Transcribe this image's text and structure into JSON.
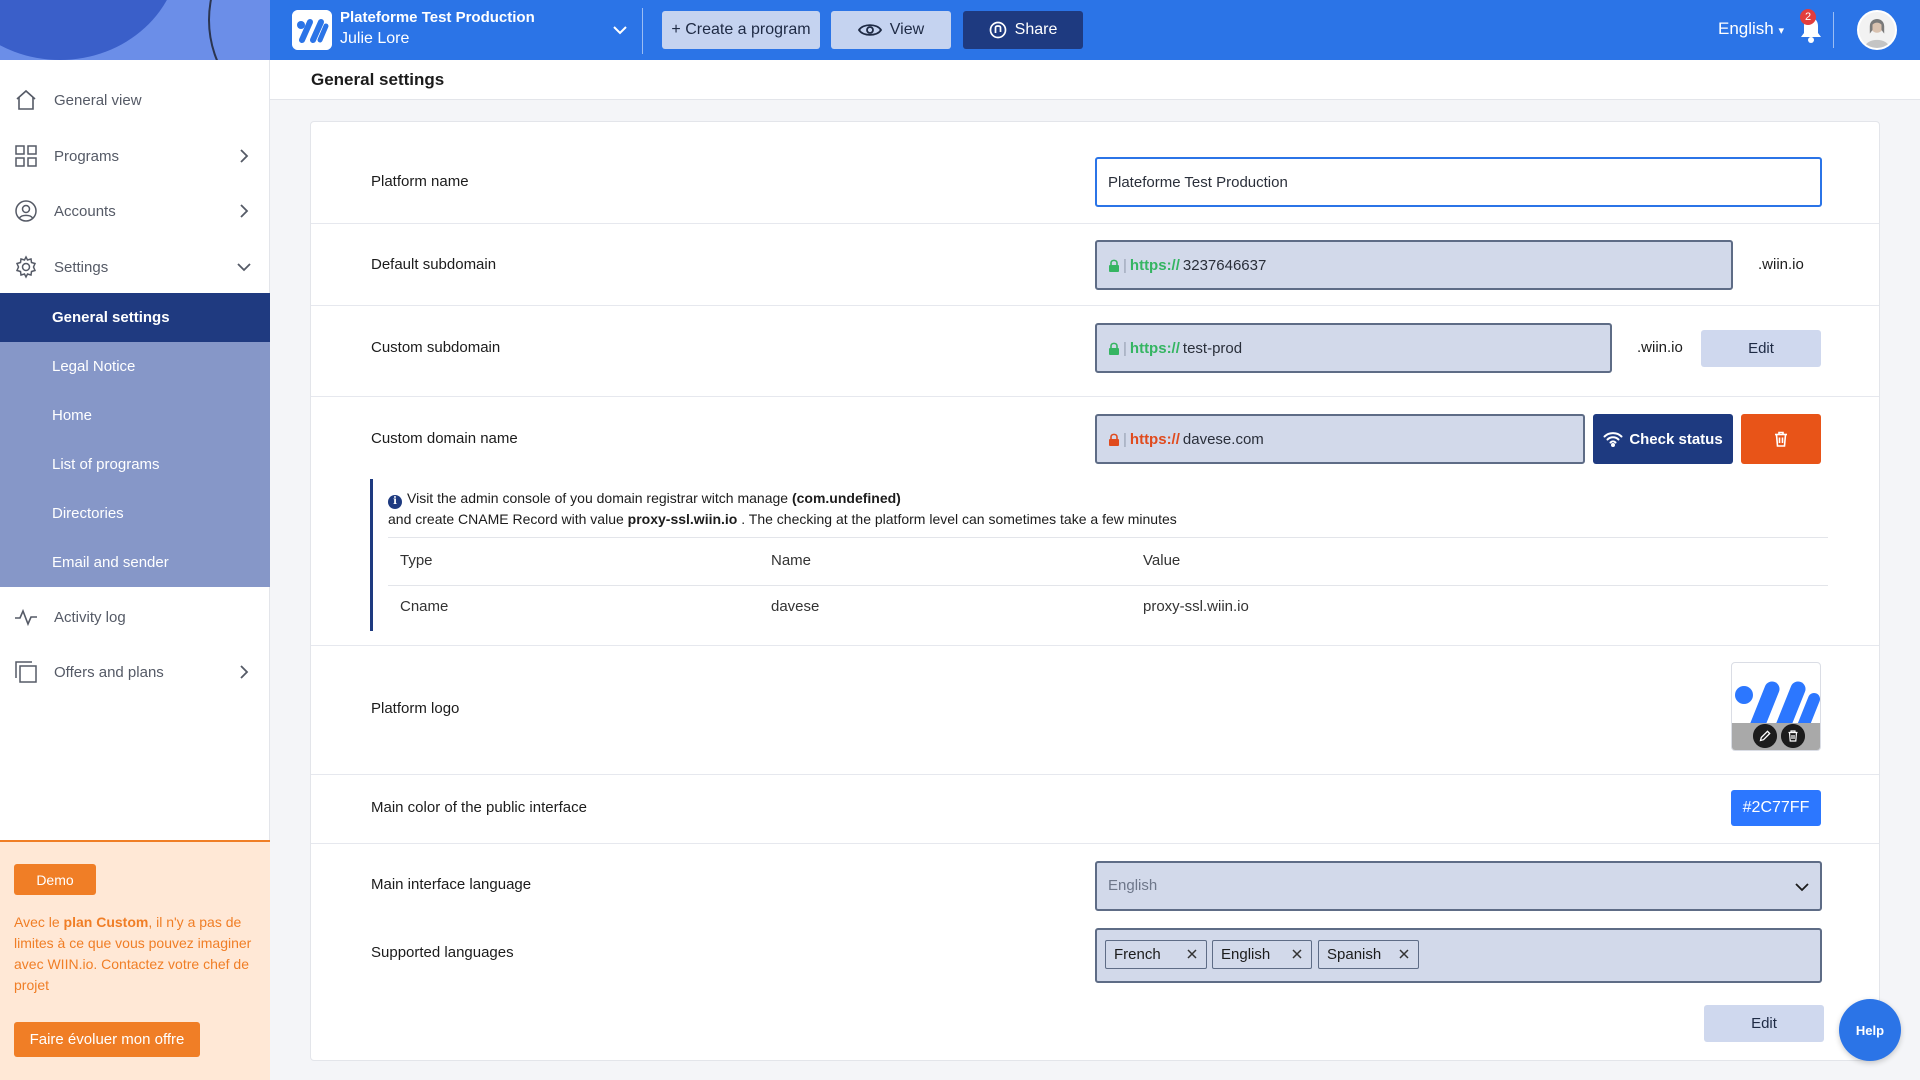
{
  "topbar": {
    "platform_name": "Plateforme Test Production",
    "user_name": "Julie Lore",
    "create_label": "+ Create a program",
    "view_label": "View",
    "share_label": "Share",
    "language": "English",
    "notification_count": "2",
    "accent_color": "#2B74E7"
  },
  "sidebar": {
    "items": [
      {
        "label": "General view",
        "icon": "home-icon"
      },
      {
        "label": "Programs",
        "icon": "grid-icon"
      },
      {
        "label": "Accounts",
        "icon": "user-circle-icon"
      },
      {
        "label": "Settings",
        "icon": "gear-icon"
      },
      {
        "label": "Activity log",
        "icon": "activity-icon"
      },
      {
        "label": "Offers and plans",
        "icon": "copy-icon"
      }
    ],
    "settings_submenu": [
      {
        "label": "General settings",
        "active": true
      },
      {
        "label": "Legal Notice"
      },
      {
        "label": "Home"
      },
      {
        "label": "List of programs"
      },
      {
        "label": "Directories"
      },
      {
        "label": "Email and sender"
      }
    ],
    "promo": {
      "badge": "Demo",
      "text_before": "Avec le ",
      "text_bold": "plan Custom",
      "text_after": ", il n'y a pas de limites à ce que vous pouvez imaginer avec WIIN.io. Contactez votre chef de projet",
      "button": "Faire évoluer mon offre"
    }
  },
  "page": {
    "title": "General settings"
  },
  "settings": {
    "platform_name": {
      "label": "Platform name",
      "value": "Plateforme Test Production"
    },
    "default_subdomain": {
      "label": "Default subdomain",
      "protocol": "https://",
      "value": "3237646637",
      "suffix": ".wiin.io"
    },
    "custom_subdomain": {
      "label": "Custom subdomain",
      "protocol": "https://",
      "value": "test-prod",
      "suffix": ".wiin.io",
      "edit_label": "Edit"
    },
    "custom_domain": {
      "label": "Custom domain name",
      "protocol": "https://",
      "value": "davese.com",
      "check_label": "Check status",
      "info_line1_before": "Visit the admin console of you domain registrar witch manage ",
      "info_line1_bold": "(com.undefined)",
      "info_line2_before": "and create CNAME Record with value ",
      "info_line2_bold": "proxy-ssl.wiin.io",
      "info_line2_after": " . The checking at the platform level can sometimes take a few minutes",
      "table_headers": [
        "Type",
        "Name",
        "Value"
      ],
      "table_row": [
        "Cname",
        "davese",
        "proxy-ssl.wiin.io"
      ]
    },
    "platform_logo": {
      "label": "Platform logo"
    },
    "main_color": {
      "label": "Main color of the public interface",
      "value": "#2C77FF"
    },
    "main_language": {
      "label": "Main interface language",
      "value": "English"
    },
    "supported_languages": {
      "label": "Supported languages",
      "tags": [
        "French",
        "English",
        "Spanish"
      ]
    },
    "edit_label": "Edit"
  },
  "help": {
    "label": "Help"
  }
}
